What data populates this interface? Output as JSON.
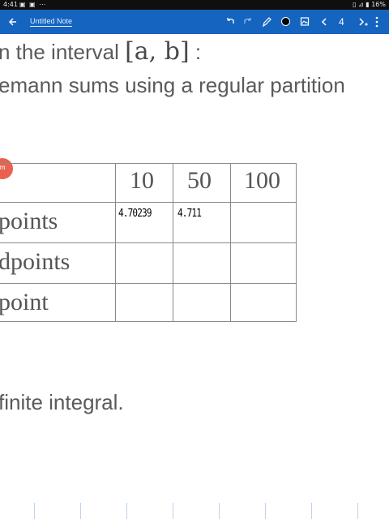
{
  "status_bar": {
    "time": "4:41",
    "icons_left": "▣ ▣ ⋯",
    "battery": "16%",
    "icons_right": "▯ ⊿ ▮"
  },
  "app_bar": {
    "title": "Untitled Note",
    "page_number": "4",
    "pen_color": "#000000",
    "background_color": "#1565c0"
  },
  "note": {
    "line1_text": "n the interval ",
    "line1_math": "[a, b]",
    "line1_tail": " :",
    "line2_text": "emann sums using a regular partition",
    "bottom_text": "finite integral.",
    "logo": "m",
    "table": {
      "columns": [
        "10",
        "50",
        "100"
      ],
      "rows": [
        "points",
        "dpoints",
        "point"
      ],
      "handwritten": [
        "4.70239",
        "4.711"
      ]
    }
  }
}
